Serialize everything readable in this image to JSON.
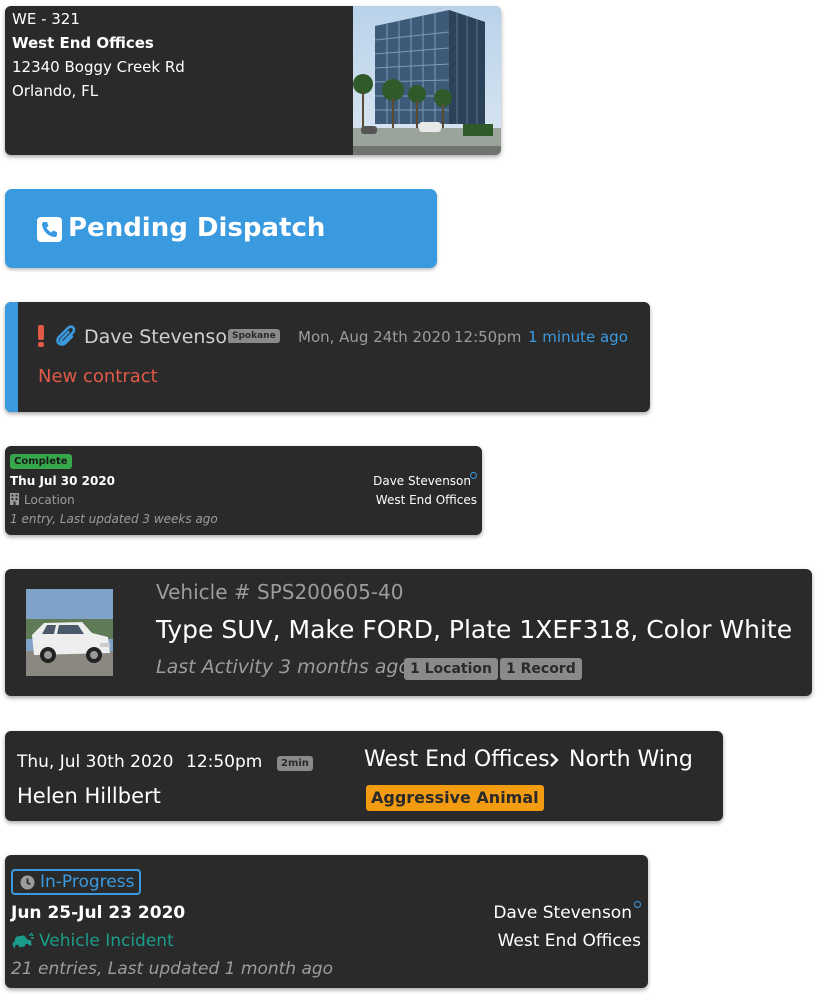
{
  "site_card": {
    "code": "WE - 321",
    "name": "West End Offices",
    "street": "12340 Boggy Creek Rd",
    "city": "Orlando, FL",
    "photo_icon": "office-building-photo"
  },
  "dispatch_button": {
    "icon": "phone-square-icon",
    "label": "Pending Dispatch",
    "color": "#3a9ae0"
  },
  "note_card": {
    "alert_icon": "exclamation-icon",
    "attachment_icon": "paperclip-icon",
    "author": "Dave Stevenson",
    "tag": "Spokane",
    "date": "Mon, Aug 24th 2020",
    "time": "12:50pm",
    "relative": "1 minute ago",
    "text": "New contract",
    "accent_color": "#3a9ae0",
    "text_color": "#e05a47"
  },
  "complete_card": {
    "status": "Complete",
    "status_color": "#36a84b",
    "date": "Thu Jul 30 2020",
    "building_icon": "building-icon",
    "location_label": "Location",
    "summary": "1 entry, Last updated 3 weeks ago",
    "person": "Dave Stevenson",
    "site": "West End Offices"
  },
  "vehicle_card": {
    "title": "Vehicle # SPS200605-40",
    "description": "Type SUV, Make FORD, Plate 1XEF318, Color White",
    "last_activity": "Last Activity 3 months ago",
    "badges": [
      "1 Location",
      "1 Record"
    ],
    "photo_icon": "white-suv-photo"
  },
  "incident_card": {
    "date": "Thu, Jul 30th 2020",
    "time": "12:50pm",
    "duration": "2min",
    "person": "Helen Hillbert",
    "location": "West End Offices",
    "sublocation": "North Wing",
    "chevron_icon": "chevron-right-icon",
    "tag": "Aggressive Animal",
    "tag_color": "#f39c12"
  },
  "progress_card": {
    "status": "In-Progress",
    "status_icon": "clock-icon",
    "status_color": "#3a9ae0",
    "dates": "Jun 25-Jul 23 2020",
    "type_icon": "car-crash-icon",
    "type": "Vehicle Incident",
    "type_color": "#1a9c8a",
    "summary": "21 entries, Last updated 1 month ago",
    "person": "Dave Stevenson",
    "site": "West End Offices"
  }
}
